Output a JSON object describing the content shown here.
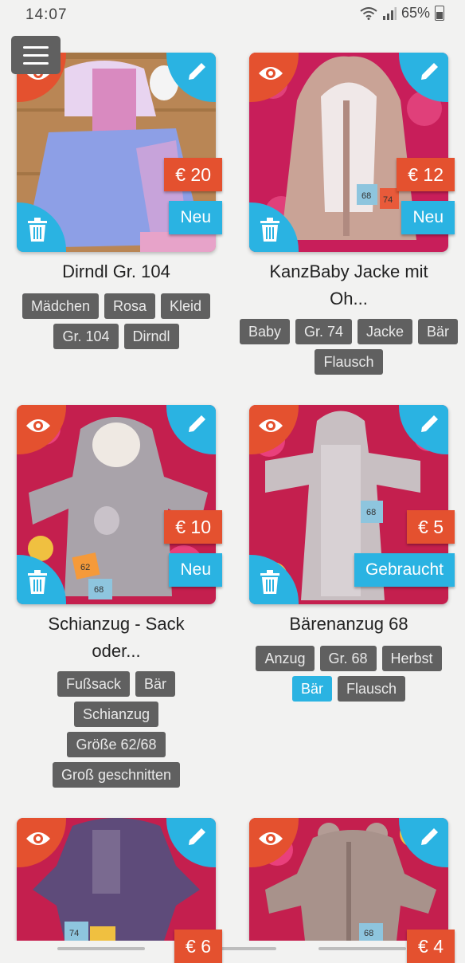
{
  "status_bar": {
    "time": "14:07",
    "battery": "65%",
    "icons": [
      "wifi-icon",
      "signal-icon",
      "battery-icon"
    ]
  },
  "menu": {
    "icon": "hamburger-menu-icon"
  },
  "colors": {
    "accent_red": "#e4512f",
    "accent_blue": "#2ab3e2",
    "tag_gray": "#606060"
  },
  "items": [
    {
      "title": "Dirndl Gr. 104",
      "price": "€ 20",
      "condition": "Neu",
      "tags": [
        "Mädchen",
        "Rosa",
        "Kleid",
        "Gr. 104",
        "Dirndl"
      ]
    },
    {
      "title": "KanzBaby Jacke mit Oh...",
      "price": "€ 12",
      "condition": "Neu",
      "tags": [
        "Baby",
        "Gr. 74",
        "Jacke",
        "Bär",
        "Flausch"
      ],
      "photo_labels": [
        "68",
        "74"
      ]
    },
    {
      "title": "Schianzug - Sack oder...",
      "price": "€ 10",
      "condition": "Neu",
      "tags": [
        "Fußsack",
        "Bär",
        "Schianzug",
        "Größe 62/68",
        "Groß geschnitten"
      ],
      "photo_labels": [
        "62",
        "68"
      ]
    },
    {
      "title": "Bärenanzug 68",
      "price": "€ 5",
      "condition": "Gebraucht",
      "tags": [
        "Anzug",
        "Gr. 68",
        "Herbst",
        "Bär",
        "Flausch"
      ],
      "active_tag": "Bär",
      "photo_labels": [
        "68"
      ]
    },
    {
      "price": "€ 6",
      "photo_labels": [
        "74"
      ]
    },
    {
      "price": "€ 4",
      "photo_labels": [
        "68"
      ]
    }
  ]
}
